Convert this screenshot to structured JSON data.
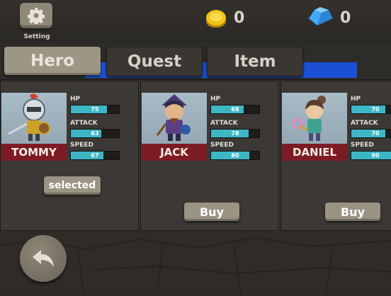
{
  "topbar": {
    "setting_label": "Setting",
    "coins": "0",
    "gems": "0"
  },
  "tabs": [
    {
      "label": "Hero",
      "active": true
    },
    {
      "label": "Quest",
      "active": false
    },
    {
      "label": "Item",
      "active": false
    }
  ],
  "heroes": [
    {
      "name": "TOMMY",
      "stats": [
        {
          "label": "HP",
          "value": 75
        },
        {
          "label": "ATTACK",
          "value": 63
        },
        {
          "label": "SPEED",
          "value": 67
        }
      ],
      "action": "selected"
    },
    {
      "name": "JACK",
      "stats": [
        {
          "label": "HP",
          "value": 68
        },
        {
          "label": "ATTACK",
          "value": 78
        },
        {
          "label": "SPEED",
          "value": 80
        }
      ],
      "action": "Buy"
    },
    {
      "name": "DANIEL",
      "stats": [
        {
          "label": "HP",
          "value": 70
        },
        {
          "label": "ATTACK",
          "value": 70
        },
        {
          "label": "SPEED",
          "value": 90
        }
      ],
      "action": "Buy"
    }
  ],
  "stat_max": 100,
  "colors": {
    "bar_fill": "#3db7c6",
    "name_plate": "#7d1b24",
    "blue_strip": "#1b4fd6"
  }
}
